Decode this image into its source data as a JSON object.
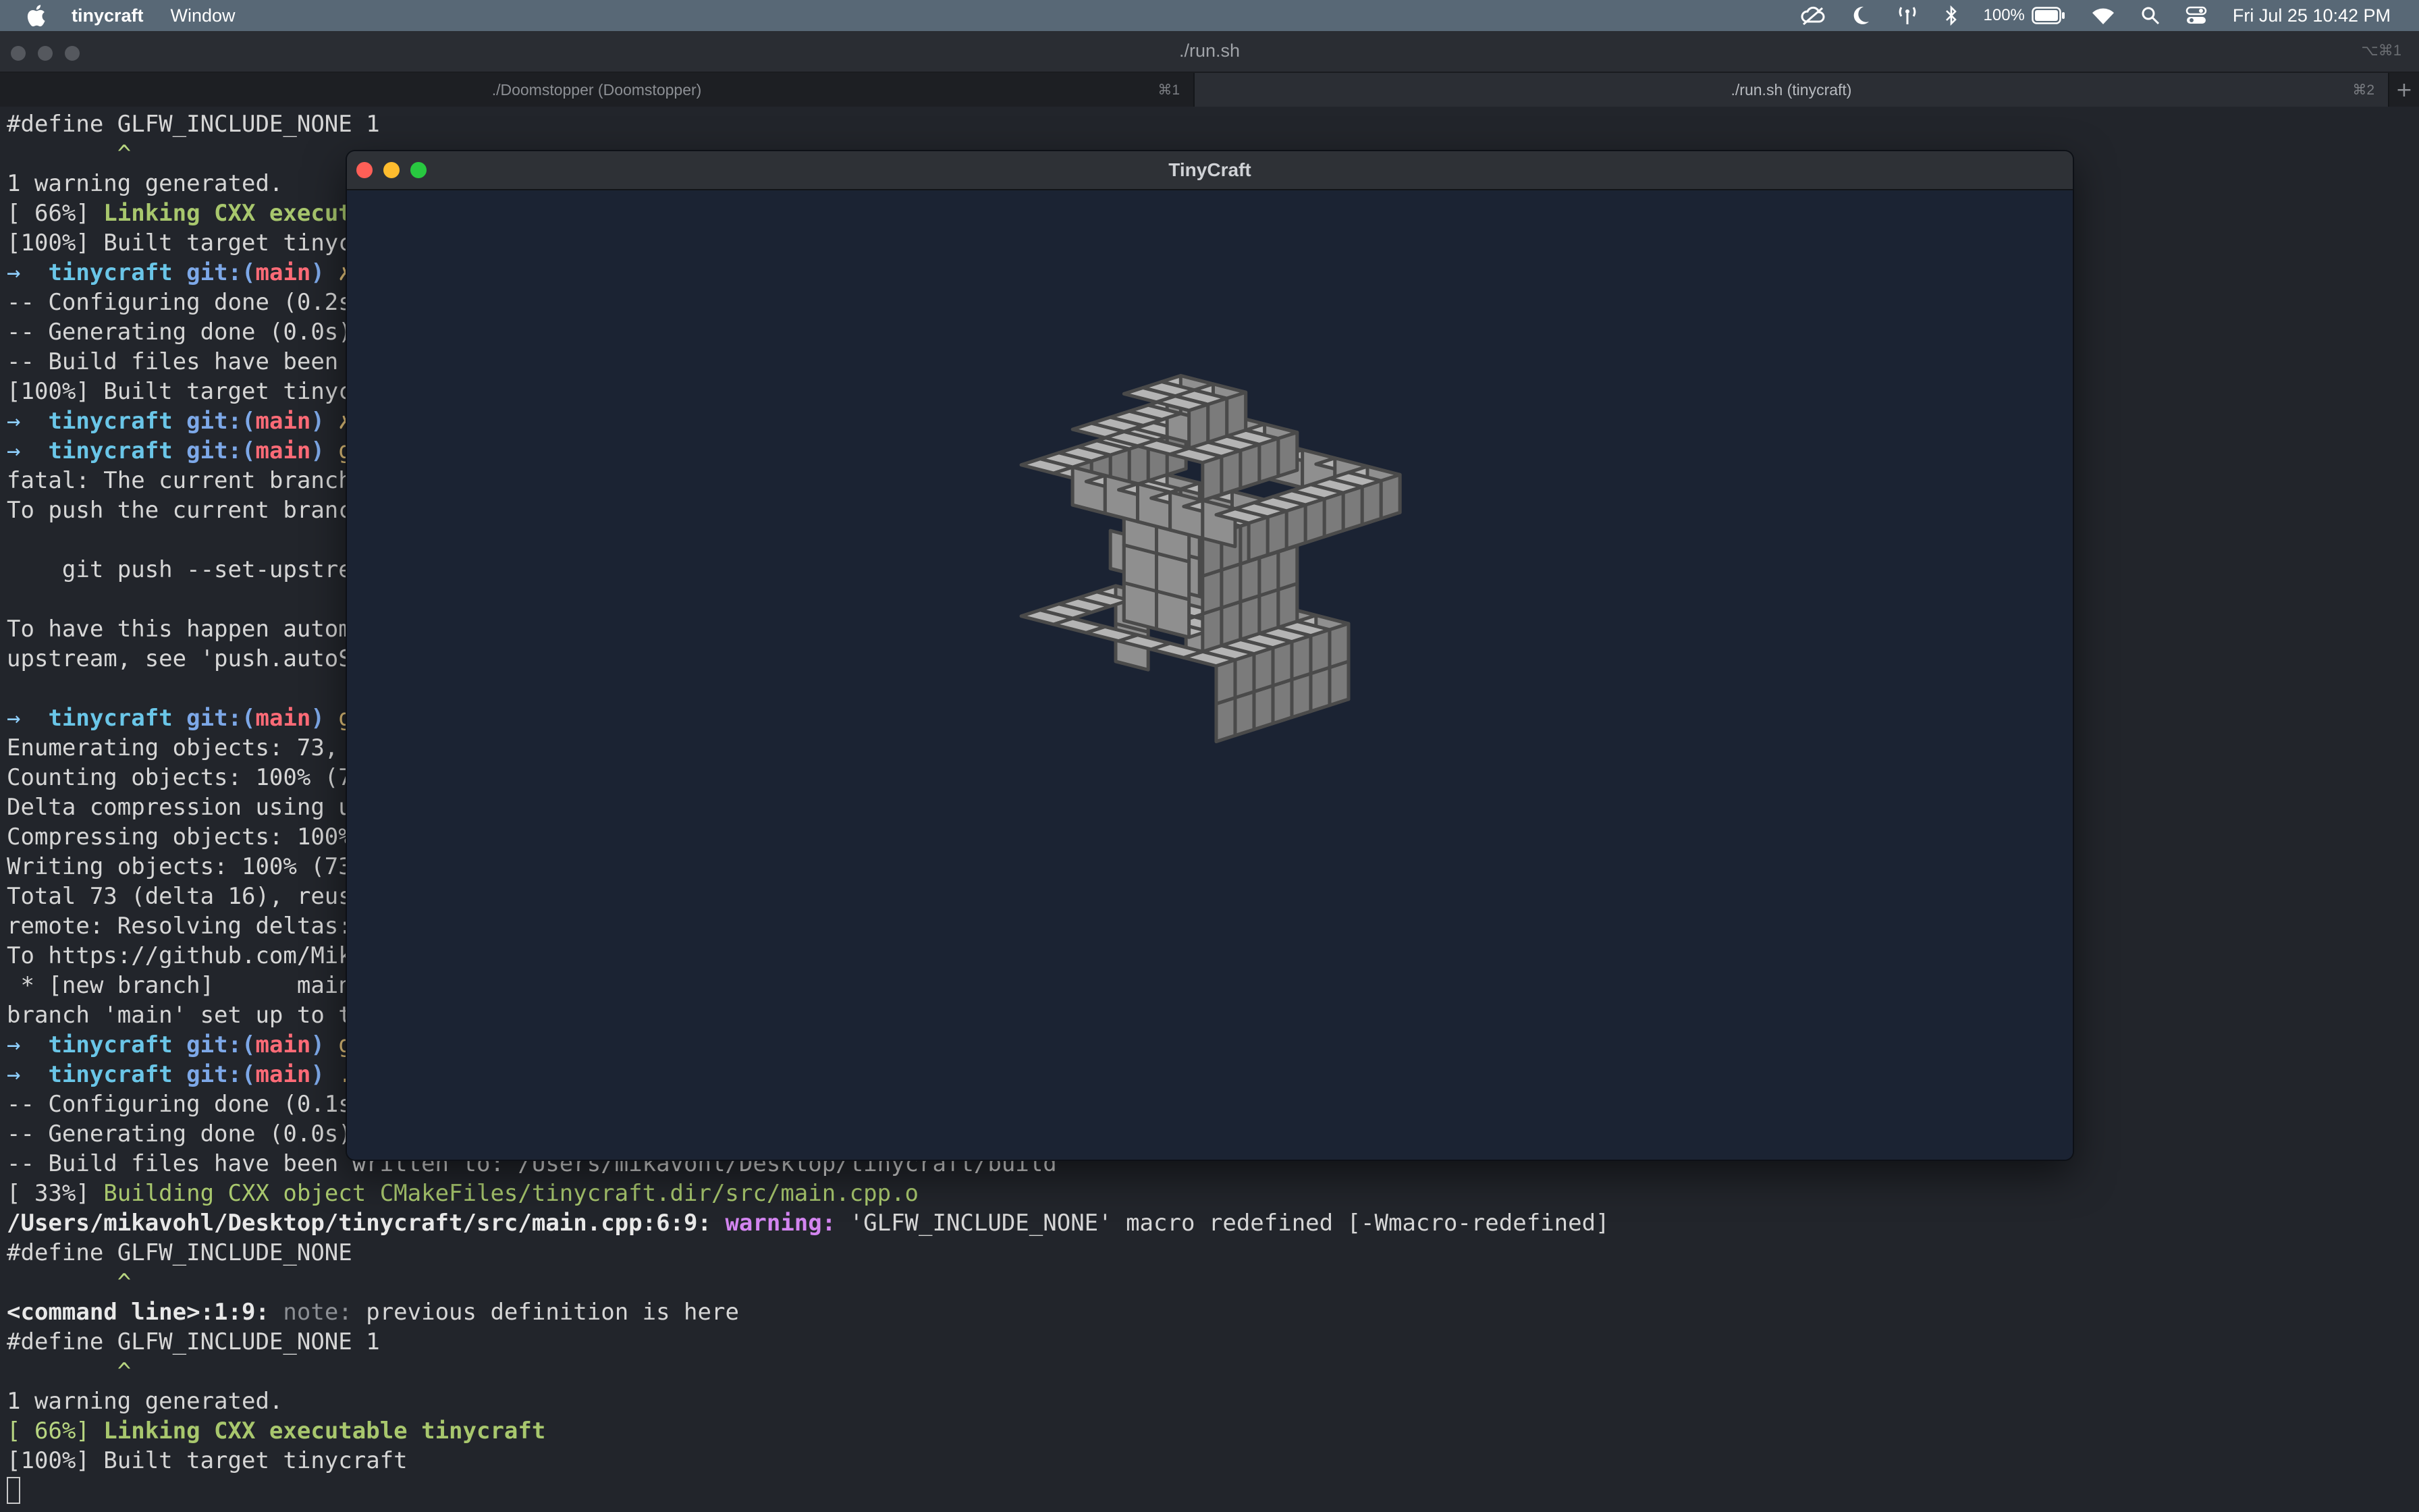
{
  "menubar": {
    "app_name": "tinycraft",
    "menu_window": "Window",
    "battery": "100%",
    "clock": "Fri Jul 25  10:42 PM",
    "icons": [
      "apple-icon",
      "cloud-icon",
      "moon-icon",
      "antenna-icon",
      "bluetooth-icon",
      "battery-icon",
      "wifi-icon",
      "search-icon",
      "control-center-icon"
    ]
  },
  "terminal": {
    "title": "./run.sh",
    "title_shortcut": "⌥⌘1",
    "tabs": [
      {
        "label": "./Doomstopper (Doomstopper)",
        "shortcut": "⌘1"
      },
      {
        "label": "./run.sh (tinycraft)",
        "shortcut": "⌘2"
      }
    ],
    "lines": [
      "#define GLFW_INCLUDE_NONE 1",
      "        ^",
      "1 warning generated.",
      "[ 66%] Linking CXX execut",
      "[100%] Built target tinyc",
      "→  tinycraft git:(main) ✗",
      "-- Configuring done (0.2s",
      "-- Generating done (0.0s)",
      "-- Build files have been ",
      "[100%] Built target tinyc",
      "→  tinycraft git:(main) ✗",
      "→  tinycraft git:(main) g",
      "fatal: The current branch",
      "To push the current branc",
      "",
      "    git push --set-upstre",
      "",
      "To have this happen autom",
      "upstream, see 'push.autoS",
      "",
      "→  tinycraft git:(main) g",
      "Enumerating objects: 73, ",
      "Counting objects: 100% (7",
      "Delta compression using u",
      "Compressing objects: 100%",
      "Writing objects: 100% (73",
      "Total 73 (delta 16), reus",
      "remote: Resolving deltas:",
      "To https://github.com/Mik",
      " * [new branch]      main",
      "branch 'main' set up to t",
      "→  tinycraft git:(main) g",
      "→  tinycraft git:(main) .",
      "-- Configuring done (0.1s",
      "-- Generating done (0.0s)",
      "-- Build files have been written to: /Users/mikavohl/Desktop/tinycraft/build",
      "[ 33%] Building CXX object CMakeFiles/tinycraft.dir/src/main.cpp.o",
      "/Users/mikavohl/Desktop/tinycraft/src/main.cpp:6:9: warning: 'GLFW_INCLUDE_NONE' macro redefined [-Wmacro-redefined]",
      "#define GLFW_INCLUDE_NONE",
      "        ^",
      "<command line>:1:9: note: previous definition is here",
      "#define GLFW_INCLUDE_NONE 1",
      "        ^",
      "1 warning generated.",
      "[ 66%] Linking CXX executable tinycraft",
      "[100%] Built target tinycraft"
    ]
  },
  "tinycraft": {
    "title": "TinyCraft",
    "colors": {
      "sky": "#1b2333",
      "block_top": "#b4b4b4",
      "block_left": "#8f8f8f",
      "block_right": "#7b7b7b",
      "block_edge": "#4a4a4a"
    }
  }
}
